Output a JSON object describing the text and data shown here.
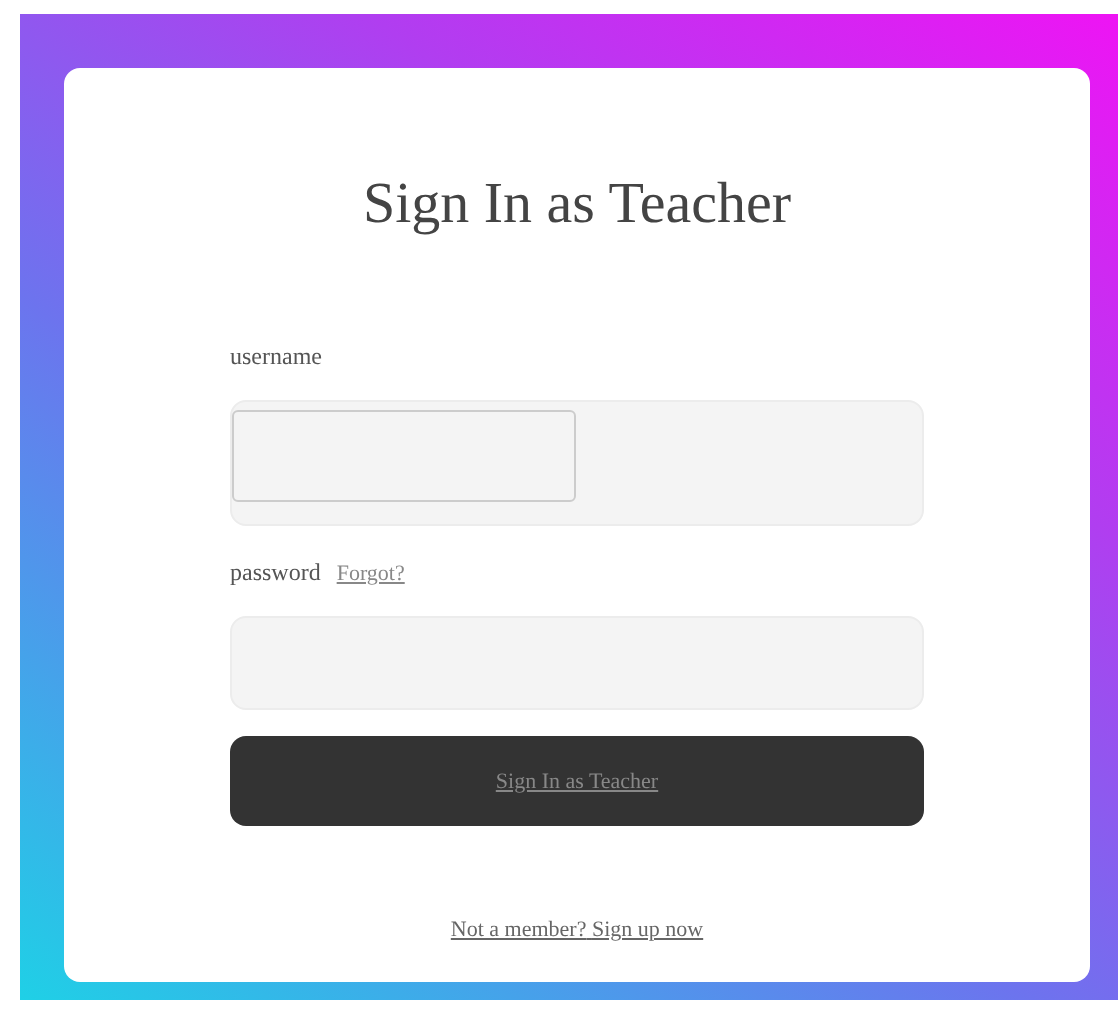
{
  "title": "Sign In as Teacher",
  "fields": [
    {
      "label": "username",
      "kind": "text"
    },
    {
      "label": "password",
      "kind": "password",
      "link": "Forgot?"
    }
  ],
  "submit": "Sign In as Teacher",
  "footer": {
    "text": "Not a member?",
    "link": "Sign up now"
  }
}
